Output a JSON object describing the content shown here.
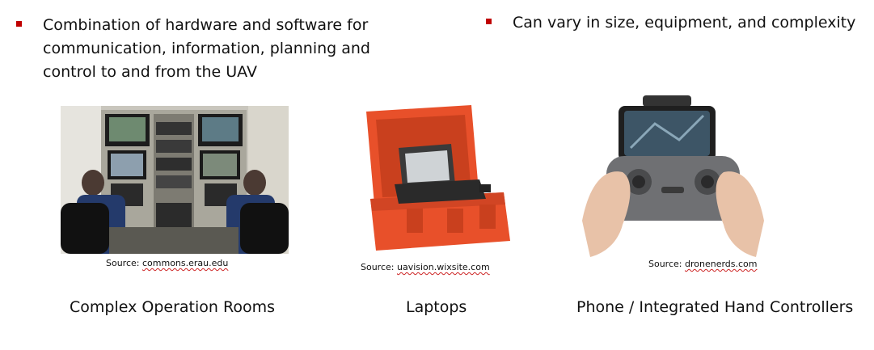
{
  "bullets": [
    {
      "text": "Combination of hardware and software for communication, information, planning and control to and from the UAV"
    },
    {
      "text": "Can vary in size, equipment, and complexity"
    }
  ],
  "panels": [
    {
      "source_prefix": "Source: ",
      "source_link": "commons.erau.edu",
      "caption": "Complex Operation Rooms"
    },
    {
      "source_prefix": "Source: ",
      "source_link": "uavision.wixsite.com",
      "caption": "Laptops"
    },
    {
      "source_prefix": "Source: ",
      "source_link": "dronenerds.com",
      "caption": "Phone / Integrated Hand Controllers"
    }
  ],
  "colors": {
    "bullet_marker": "#c00000",
    "case_orange": "#e8502a",
    "text": "#111111"
  },
  "icons": [
    "operation-room-photo",
    "rugged-laptop-case-photo",
    "hand-controller-photo"
  ]
}
